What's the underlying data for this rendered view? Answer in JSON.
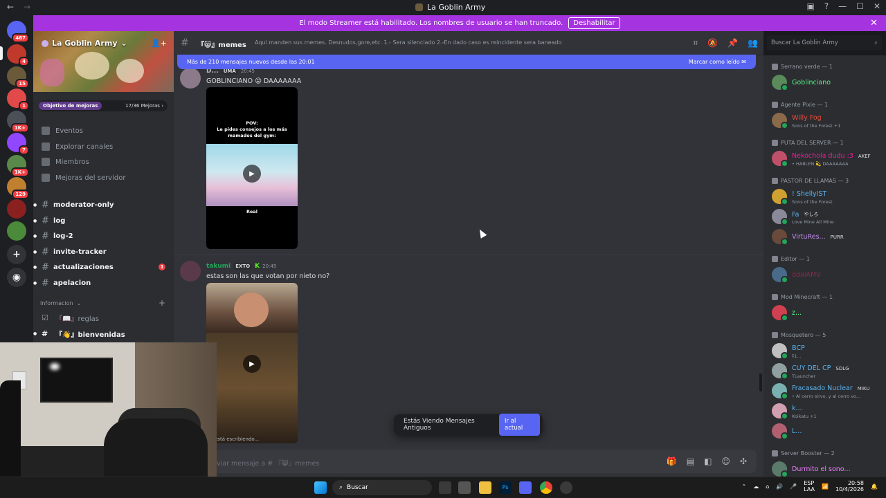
{
  "window": {
    "title": "La Goblin Army",
    "back": "←",
    "forward": "→"
  },
  "banner": {
    "text": "El modo Streamer está habilitado. Los nombres de usuario se han truncado.",
    "button": "Deshabilitar",
    "close": "✕"
  },
  "guilds": [
    {
      "badge": "467",
      "color": "#5865f2"
    },
    {
      "badge": "4",
      "color": "#c0392b"
    },
    {
      "badge": "15",
      "color": "#6a5a3a"
    },
    {
      "badge": "1",
      "color": "#e24a4a"
    },
    {
      "badge": "1K+",
      "color": "#4a4f58"
    },
    {
      "badge": "7",
      "color": "#9146ff"
    },
    {
      "badge": "1K+",
      "color": "#5a8a4a"
    },
    {
      "badge": "129",
      "color": "#c08030"
    },
    {
      "badge": "",
      "color": "#8a2020"
    },
    {
      "badge": "",
      "color": "#4a8a3a"
    }
  ],
  "server": {
    "name": "La Goblin Army",
    "goal_label": "Objetivo de mejoras",
    "goal_progress": "17/36 Mejoras",
    "nav": [
      "Eventos",
      "Explorar canales",
      "Miembros",
      "Mejoras del servidor"
    ],
    "channels": [
      {
        "name": "moderator-only",
        "unread": ""
      },
      {
        "name": "log",
        "unread": ""
      },
      {
        "name": "log-2",
        "unread": ""
      },
      {
        "name": "invite-tracker",
        "unread": ""
      },
      {
        "name": "actualizaciones",
        "unread": "1"
      },
      {
        "name": "apelacion",
        "unread": ""
      }
    ],
    "category": "Informacion",
    "sub_channels": [
      {
        "name": "『📖』reglas"
      },
      {
        "name": "『👋』bienvenidas"
      }
    ]
  },
  "chat": {
    "channel_name": "『😸』memes",
    "topic": "Aqui manden sus memes. Desnudos,gore,etc. 1.- Sera silenciado 2.-En dado caso es reincidente sera baneado",
    "new_messages": "Más de 210 mensajes nuevos desde las 20:01",
    "mark_read": "Marcar como leído",
    "messages": [
      {
        "author": "D...",
        "author_color": "#b5bac1",
        "tag": "UMA",
        "time": "20:45",
        "text": "GOBLINCIANO 😝 DAAAAAAA",
        "video_pov": "POV:\nLe pides consejos a los más mamados del gym:",
        "video_caption": "Real"
      },
      {
        "author": "takumi",
        "author_color": "#23a55a",
        "tag": "EXTO",
        "time": "20:45",
        "text": "estas son las que votan por nieto no?"
      }
    ],
    "typing": "está escribiendo...",
    "old_messages": "Estás Viendo Mensajes Antiguos",
    "jump_button": "Ir al actual",
    "composer_placeholder": "viar mensaje a # 『😸』memes"
  },
  "members_search": "Buscar La Goblin Army",
  "member_groups": [
    {
      "role": "Serrano verde — 1",
      "members": [
        {
          "name": "Goblinciano",
          "color": "#57f287",
          "status": "",
          "tag": ""
        }
      ]
    },
    {
      "role": "Agente Pixie — 1",
      "members": [
        {
          "name": "Willy Fog",
          "color": "#e74c3c",
          "status": "Sons of the Forest +1",
          "tag": ""
        }
      ]
    },
    {
      "role": "PUTA DEL SERVER — 1",
      "members": [
        {
          "name": "Nekochola dudu :3",
          "color": "#e91e9b",
          "status": "• HABLEN 💫 DAAAAAAA",
          "tag": "AKEF"
        }
      ]
    },
    {
      "role": "PASTOR DE LLAMAS — 3",
      "members": [
        {
          "name": "! ShellyIST",
          "color": "#5ab4f0",
          "status": "Sons of the Forest",
          "tag": ""
        },
        {
          "name": "Fa",
          "color": "#5ab4f0",
          "status": "Love Mine All Mine",
          "tag": "やしろ"
        },
        {
          "name": "VirtuRes...",
          "color": "#c38cf0",
          "status": "",
          "tag": "PURR"
        }
      ]
    },
    {
      "role": "Editor — 1",
      "members": [
        {
          "name": "ddalAMV",
          "color": "#8a2a4a",
          "status": "",
          "tag": ""
        }
      ]
    },
    {
      "role": "Mod Minecraft — 1",
      "members": [
        {
          "name": "z...",
          "color": "#57f287",
          "status": "",
          "tag": ""
        }
      ]
    },
    {
      "role": "Mosquetero — 5",
      "members": [
        {
          "name": "BCP",
          "color": "#5ab4f0",
          "status": "ʢ1...",
          "tag": ""
        },
        {
          "name": "CUY DEL CP",
          "color": "#5ab4f0",
          "status": "TLauncher",
          "tag": "SDLG"
        },
        {
          "name": "Fracasado Nuclear",
          "color": "#5ab4f0",
          "status": "• Al cerro sirvo, y al cerro vo...",
          "tag": "MIKU"
        },
        {
          "name": "k...",
          "color": "#5ab4f0",
          "status": "Koikatu +1",
          "tag": ""
        },
        {
          "name": "L...",
          "color": "#5ab4f0",
          "status": "",
          "tag": ""
        }
      ]
    },
    {
      "role": "Server Booster — 2",
      "members": [
        {
          "name": "Durmito el sono...",
          "color": "#f47fff",
          "status": "",
          "tag": ""
        }
      ]
    }
  ],
  "taskbar": {
    "search": "Buscar",
    "lang": "ESP",
    "lang2": "LAA",
    "time": "20:58",
    "date": "10/4/2026"
  }
}
